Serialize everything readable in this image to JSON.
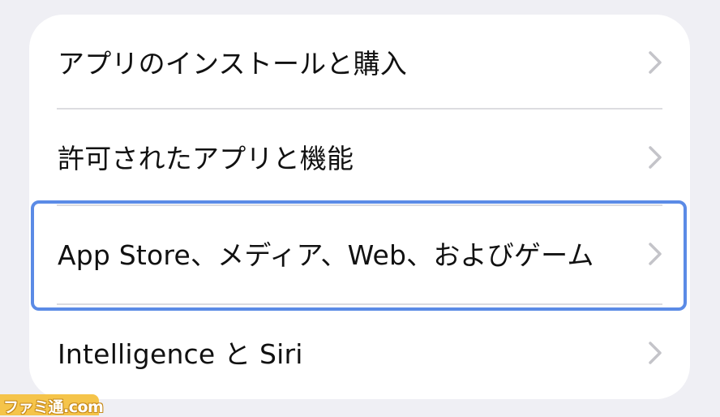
{
  "settings_list": {
    "items": [
      {
        "label": "アプリのインストールと購入",
        "icon": "chevron-right-icon"
      },
      {
        "label": "許可されたアプリと機能",
        "icon": "chevron-right-icon"
      },
      {
        "label": "App Store、メディア、Web、およびゲーム",
        "icon": "chevron-right-icon",
        "highlighted": true
      },
      {
        "label": "Intelligence と Siri",
        "icon": "chevron-right-icon"
      }
    ]
  },
  "watermark": {
    "text": "ファミ通.com"
  },
  "colors": {
    "background": "#efeff4",
    "card": "#ffffff",
    "highlight_border": "#5b8be6",
    "chevron": "#c4c4c9",
    "divider": "#dcdce0"
  }
}
